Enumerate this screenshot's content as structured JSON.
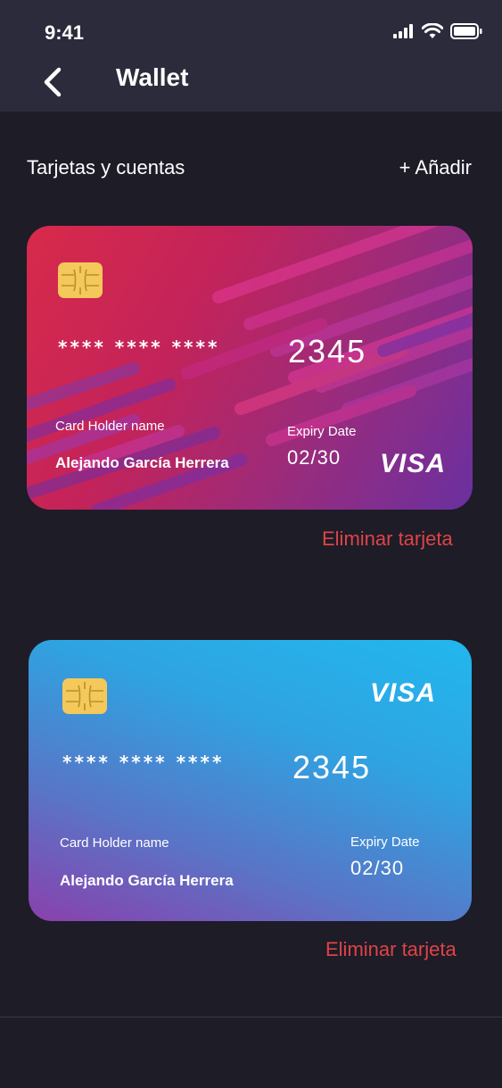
{
  "status_bar": {
    "time": "9:41"
  },
  "nav": {
    "title": "Wallet"
  },
  "section": {
    "title": "Tarjetas y cuentas",
    "add_label": "+ Añadir"
  },
  "cards": [
    {
      "masked": "**** **** ****",
      "last4": "2345",
      "holder_label": "Card Holder name",
      "holder_name": "Alejando García Herrera",
      "expiry_label": "Expiry Date",
      "expiry": "02/30",
      "brand": "VISA",
      "remove_label": "Eliminar tarjeta",
      "colors": [
        "#d82a4a",
        "#6a30a0"
      ]
    },
    {
      "masked": "**** **** ****",
      "last4": "2345",
      "holder_label": "Card Holder name",
      "holder_name": "Alejando García Herrera",
      "expiry_label": "Expiry Date",
      "expiry": "02/30",
      "brand": "VISA",
      "remove_label": "Eliminar tarjeta",
      "colors": [
        "#22b7ee",
        "#8a40ad"
      ]
    }
  ],
  "colors": {
    "background": "#1d1c27",
    "topbar": "#2c2b3c",
    "danger": "#de4446"
  },
  "icons": [
    "signal-icon",
    "wifi-icon",
    "battery-icon",
    "back-chevron-icon",
    "chip-icon"
  ]
}
